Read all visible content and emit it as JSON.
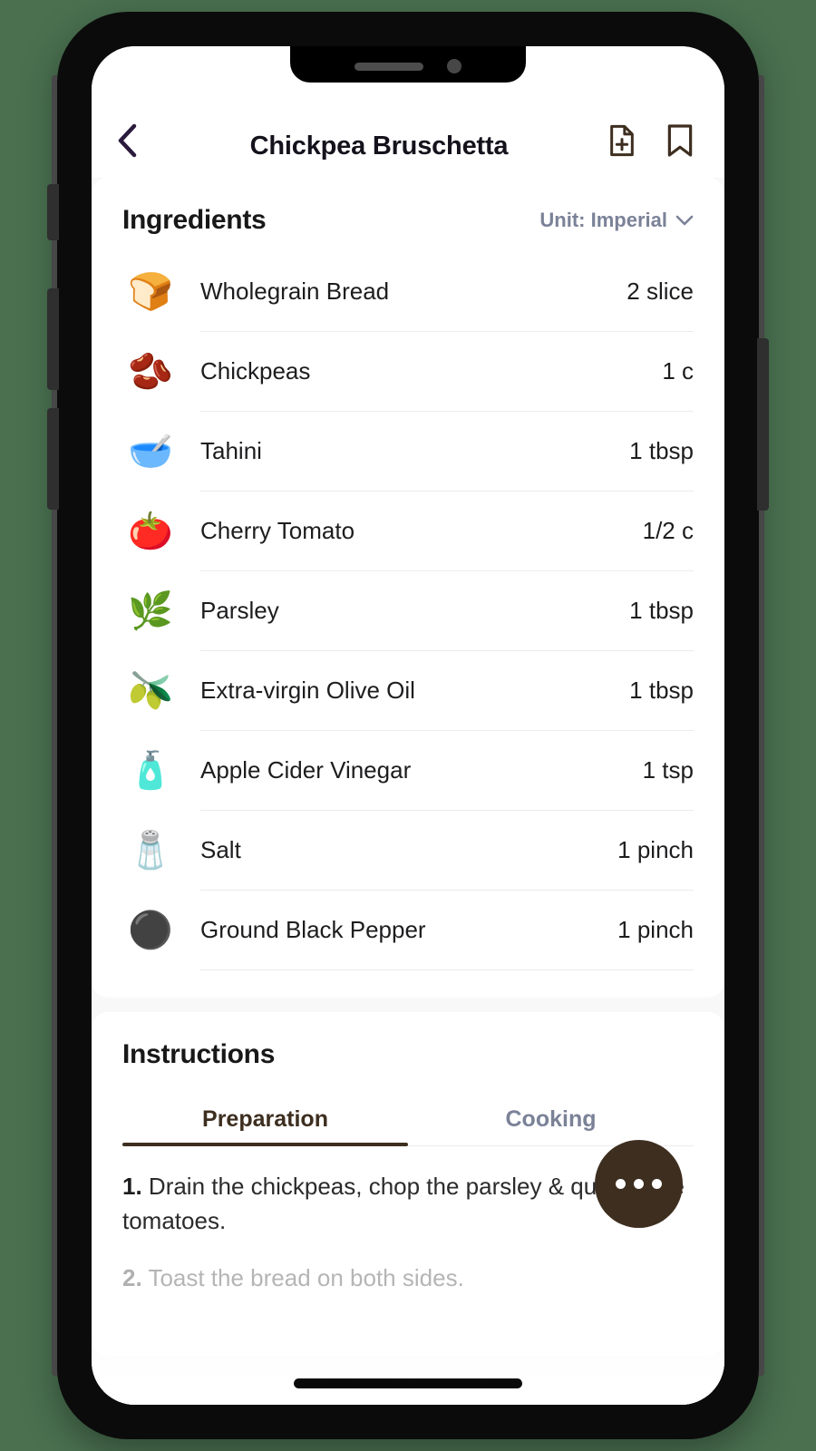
{
  "device": {
    "notch": {
      "speaker": "speaker-grille",
      "camera": "front-camera"
    },
    "buttons": {
      "silent": "silent-switch",
      "vol_up": "volume-up",
      "vol_down": "volume-down",
      "power": "power-button"
    }
  },
  "header": {
    "back_icon": "chevron-left-icon",
    "title": "Chickpea Bruschetta",
    "actions": [
      {
        "name": "add-to-plan-button",
        "icon": "file-plus-icon"
      },
      {
        "name": "bookmark-button",
        "icon": "bookmark-icon"
      }
    ]
  },
  "ingredients": {
    "title": "Ingredients",
    "unit_label": "Unit: Imperial",
    "unit_chevron": "chevron-down-icon",
    "items": [
      {
        "icon": "🍞",
        "icon_name": "bread-icon",
        "name": "Wholegrain Bread",
        "qty": "2 slice"
      },
      {
        "icon": "🫘",
        "icon_name": "chickpeas-icon",
        "name": "Chickpeas",
        "qty": "1 c"
      },
      {
        "icon": "🥣",
        "icon_name": "tahini-icon",
        "name": "Tahini",
        "qty": "1 tbsp"
      },
      {
        "icon": "🍅",
        "icon_name": "cherry-tomato-icon",
        "name": "Cherry Tomato",
        "qty": "1/2 c"
      },
      {
        "icon": "🌿",
        "icon_name": "parsley-icon",
        "name": "Parsley",
        "qty": "1 tbsp"
      },
      {
        "icon": "🫒",
        "icon_name": "olive-oil-icon",
        "name": "Extra-virgin Olive Oil",
        "qty": "1 tbsp"
      },
      {
        "icon": "🧴",
        "icon_name": "apple-cider-vinegar-icon",
        "name": "Apple Cider Vinegar",
        "qty": "1 tsp"
      },
      {
        "icon": "🧂",
        "icon_name": "salt-icon",
        "name": "Salt",
        "qty": "1 pinch"
      },
      {
        "icon": "⚫",
        "icon_name": "black-pepper-icon",
        "name": "Ground Black Pepper",
        "qty": "1 pinch"
      }
    ]
  },
  "instructions": {
    "title": "Instructions",
    "tabs": [
      {
        "label": "Preparation",
        "active": true
      },
      {
        "label": "Cooking",
        "active": false
      }
    ],
    "steps": [
      {
        "num": "1.",
        "text": " Drain the chickpeas, chop the parsley & quarter the tomatoes.",
        "dim": false
      },
      {
        "num": "2.",
        "text": " Toast the bread on both sides.",
        "dim": true
      }
    ]
  },
  "fab": {
    "name": "more-options-button",
    "icon": "ellipsis-icon"
  },
  "colors": {
    "page_background": "#4a7050",
    "screen_background": "#f8f8f9",
    "card": "#ffffff",
    "accent_brown": "#3d2e1f",
    "muted_blue_gray": "#7b8298",
    "text_primary": "#1d1d1f",
    "text_dim": "#b5b5b5",
    "divider": "#ececec",
    "back_chevron": "#2a1b3d"
  }
}
